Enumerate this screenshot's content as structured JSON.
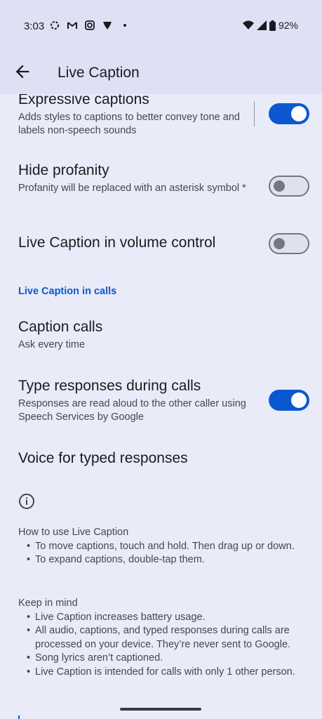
{
  "status": {
    "time": "3:03",
    "battery": "92%"
  },
  "app_bar": {
    "title": "Live Caption"
  },
  "settings": {
    "expressive": {
      "title": "Expressive captions",
      "subtitle": "Adds styles to captions to better convey tone and labels non-speech sounds",
      "enabled": true
    },
    "profanity": {
      "title": "Hide profanity",
      "subtitle": "Profanity will be replaced with an asterisk symbol *",
      "enabled": false
    },
    "volume": {
      "title": "Live Caption in volume control",
      "enabled": false
    },
    "calls_header": "Live Caption in calls",
    "caption_calls": {
      "title": "Caption calls",
      "subtitle": "Ask every time"
    },
    "type_responses": {
      "title": "Type responses during calls",
      "subtitle": "Responses are read aloud to the other caller using Speech Services by Google",
      "enabled": true
    },
    "voice": {
      "title": "Voice for typed responses"
    }
  },
  "info": {
    "how_title": "How to use Live Caption",
    "how_items": [
      "To move captions, touch and hold. Then drag up or down.",
      "To expand captions, double-tap them."
    ],
    "keep_title": "Keep in mind",
    "keep_items": [
      "Live Caption increases battery usage.",
      "All audio, captions, and typed responses during calls are processed on your device. They’re never sent to Google.",
      "Song lyrics aren’t captioned.",
      "Live Caption is intended for calls with only 1 other person."
    ]
  },
  "icons": {
    "back": "arrow-back-icon",
    "info": "info-icon",
    "wifi": "wifi-icon",
    "signal": "signal-icon",
    "battery": "battery-icon"
  },
  "colors": {
    "accent": "#0b57d0",
    "background": "#e9ecf8",
    "header_bg": "#dde1f3"
  }
}
